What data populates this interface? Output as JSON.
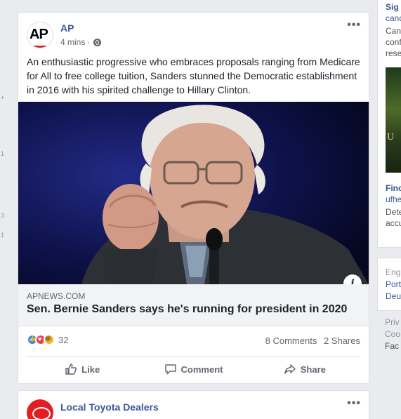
{
  "left_rail": {
    "marks": [
      "+",
      "1",
      "3",
      "1"
    ]
  },
  "post": {
    "page_name": "AP",
    "avatar_text": "AP",
    "time": "4 mins",
    "text": "An enthusiastic progressive who embraces proposals ranging from Medicare for All to free college tuition, Sanders stunned the Democratic establishment in 2016 with his spirited challenge to Hillary Clinton.",
    "link_domain": "APNEWS.COM",
    "link_title": "Sen. Bernie Sanders says he's running for president in 2020",
    "info_icon": "i",
    "reaction_count": "32",
    "comments": "8 Comments",
    "shares": "2 Shares",
    "actions": {
      "like": "Like",
      "comment": "Comment",
      "share": "Share"
    },
    "colors": {
      "link": "#385898",
      "meta": "#606770",
      "like_blue": "#2d88ff",
      "love_red": "#f33e58",
      "haha_yellow": "#f7b125"
    }
  },
  "ad": {
    "name": "Local Toyota Dealers",
    "logo_color": "#e41c23"
  },
  "right_col": {
    "lines": [
      "Sig",
      "cand",
      "Can",
      "conf",
      "rese",
      "U",
      "Finc",
      "ufhe",
      "Dete",
      "accu",
      "Eng",
      "Port",
      "Deu",
      "Priv",
      "Coo",
      "Fac"
    ]
  }
}
